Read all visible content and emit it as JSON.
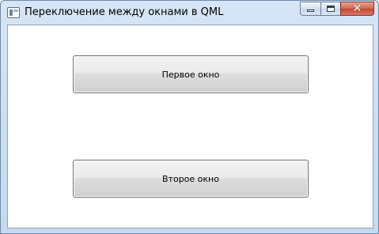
{
  "window": {
    "title": "Переключение между окнами в QML",
    "icons": {
      "app": "qml-app-icon",
      "minimize": "minimize-icon",
      "maximize": "maximize-icon",
      "close": "close-icon"
    },
    "caption": {
      "close_glyph": "✕"
    }
  },
  "main": {
    "buttons": [
      {
        "label": "Первое окно"
      },
      {
        "label": "Второе окно"
      }
    ]
  },
  "colors": {
    "titlebar": "#cfe0f3",
    "client_bg": "#ffffff",
    "close_button": "#c44a30",
    "button_border": "#707070"
  }
}
